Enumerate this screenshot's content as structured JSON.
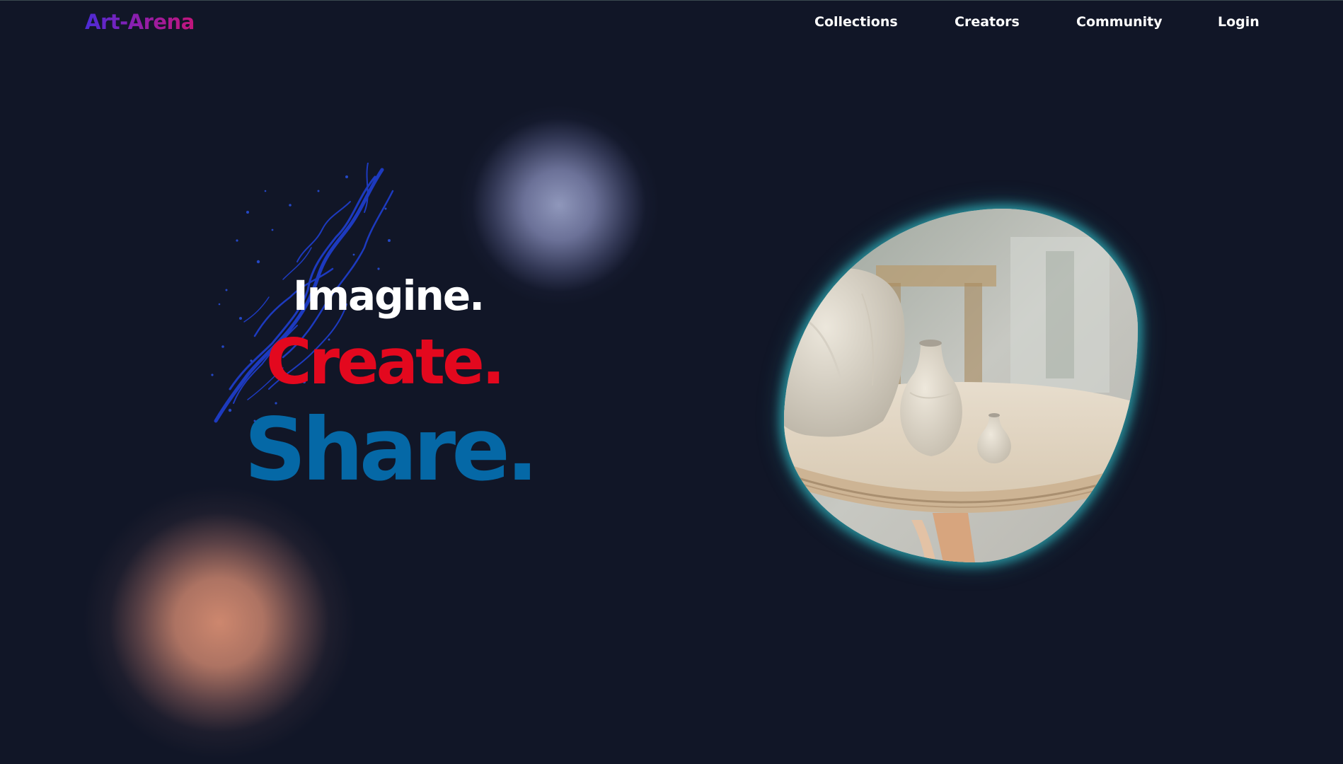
{
  "header": {
    "logo": "Art-Arena",
    "nav": [
      {
        "label": "Collections"
      },
      {
        "label": "Creators"
      },
      {
        "label": "Community"
      },
      {
        "label": "Login"
      }
    ]
  },
  "hero": {
    "line1": "Imagine.",
    "line2": "Create.",
    "line3": "Share."
  },
  "colors": {
    "background": "#111627",
    "imagine": "#ffffff",
    "create": "#e3081e",
    "share": "#0568a6",
    "blob_glow": "#2daab4",
    "logo_gradient": [
      "#4b2bd6",
      "#c2157a"
    ]
  },
  "media": {
    "hero_image": "pottery-vases-on-table"
  }
}
